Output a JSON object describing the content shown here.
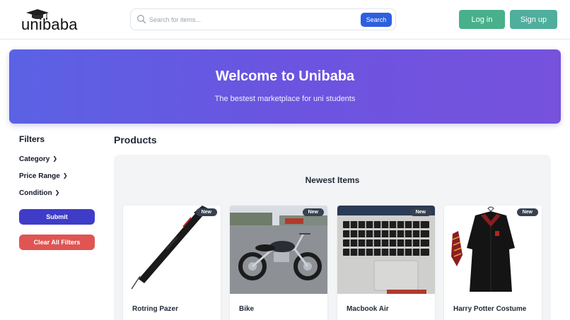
{
  "header": {
    "logo_text": "unibaba",
    "search_placeholder": "Search for items...",
    "search_button": "Search",
    "login_button": "Log in",
    "signup_button": "Sign up"
  },
  "hero": {
    "title": "Welcome to Unibaba",
    "subtitle": "The bestest marketplace for uni students"
  },
  "filters": {
    "title": "Filters",
    "items": [
      "Category",
      "Price Range",
      "Condition"
    ],
    "submit_label": "Submit",
    "clear_label": "Clear All Filters"
  },
  "products": {
    "title": "Products",
    "section_title": "Newest Items",
    "cards": [
      {
        "title": "Rotring Pazer",
        "badge": "New",
        "image": "pen"
      },
      {
        "title": "Bike",
        "badge": "New",
        "image": "motorcycle"
      },
      {
        "title": "Macbook Air",
        "badge": "New",
        "image": "laptop-keyboard"
      },
      {
        "title": "Harry Potter Costume",
        "badge": "New",
        "image": "robe-and-tie"
      }
    ]
  },
  "colors": {
    "primary": "#2e5fe0",
    "login": "#48b08b",
    "signup": "#4fae9c",
    "hero_start": "#5b62e4",
    "hero_end": "#7652dd",
    "submit": "#3f3cc8",
    "clear": "#e05553"
  }
}
